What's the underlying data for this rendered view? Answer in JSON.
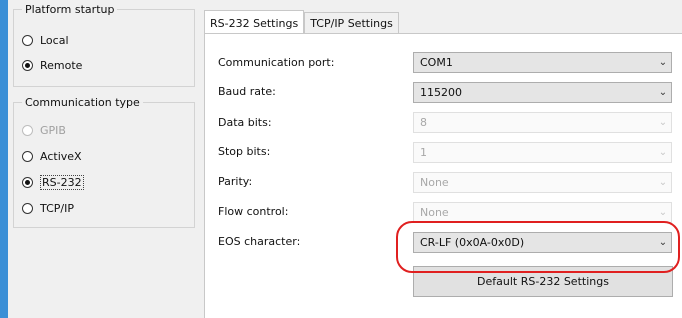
{
  "platform_startup": {
    "legend": "Platform startup",
    "options": [
      {
        "label": "Local",
        "selected": false,
        "disabled": false
      },
      {
        "label": "Remote",
        "selected": true,
        "disabled": false
      }
    ]
  },
  "communication_type": {
    "legend": "Communication type",
    "options": [
      {
        "label": "GPIB",
        "selected": false,
        "disabled": true
      },
      {
        "label": "ActiveX",
        "selected": false,
        "disabled": false
      },
      {
        "label": "RS-232",
        "selected": true,
        "disabled": false
      },
      {
        "label": "TCP/IP",
        "selected": false,
        "disabled": false
      }
    ]
  },
  "tabs": [
    {
      "label": "RS-232 Settings",
      "active": true
    },
    {
      "label": "TCP/IP Settings",
      "active": false
    }
  ],
  "settings": [
    {
      "label": "Communication port:",
      "value": "COM1",
      "disabled": false
    },
    {
      "label": "Baud rate:",
      "value": "115200",
      "disabled": false
    },
    {
      "label": "Data bits:",
      "value": "8",
      "disabled": true
    },
    {
      "label": "Stop bits:",
      "value": "1",
      "disabled": true
    },
    {
      "label": "Parity:",
      "value": "None",
      "disabled": true
    },
    {
      "label": "Flow control:",
      "value": "None",
      "disabled": true
    },
    {
      "label": "EOS character:",
      "value": "CR-LF (0x0A-0x0D)",
      "disabled": false
    }
  ],
  "default_button_label": "Default RS-232 Settings",
  "icons": {
    "dropdown": "chevron-down-icon",
    "radio": "radio-button-icon"
  },
  "colors": {
    "accent_strip": "#3b8fd6",
    "highlight": "#e02020",
    "panel_bg": "#f0f0f0"
  }
}
